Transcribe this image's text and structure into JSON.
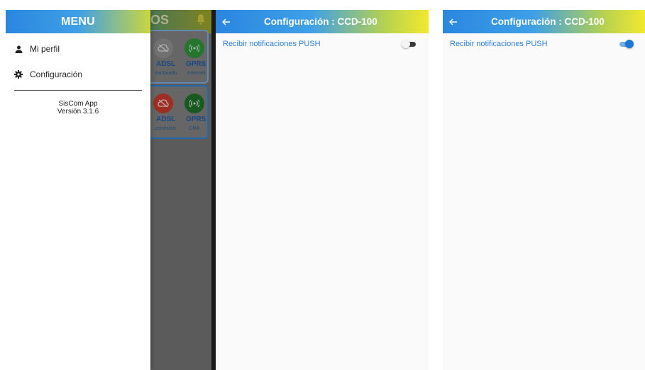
{
  "drawer": {
    "title": "MENU",
    "items": [
      {
        "label": "Mi perfil",
        "icon": "person-icon"
      },
      {
        "label": "Configuración",
        "icon": "gear-icon"
      }
    ],
    "app_name": "SisCom App",
    "app_version": "Versión 3.1.6"
  },
  "background_app": {
    "header_fragment": "OS",
    "cards": [
      {
        "left_label": "ADSL",
        "left_status": "sactivado",
        "left_color": "#8a8a8a",
        "right_label": "GPRS",
        "right_status": "Internet",
        "right_color": "#2f8f3a"
      },
      {
        "left_label": "ADSL",
        "left_status": "conexión",
        "left_color": "#c0392b",
        "right_label": "GPRS",
        "right_status": "CRA",
        "right_color": "#1f6d2a"
      }
    ]
  },
  "config_screens": [
    {
      "title": "Configuración :  CCD-100",
      "setting_label": "Recibir notificaciones PUSH",
      "push_enabled": false
    },
    {
      "title": "Configuración :  CCD-100",
      "setting_label": "Recibir notificaciones PUSH",
      "push_enabled": true
    }
  ],
  "colors": {
    "accent_blue": "#2b7fd6",
    "gradient_start": "#2a86e0",
    "gradient_end": "#f2e92e"
  }
}
